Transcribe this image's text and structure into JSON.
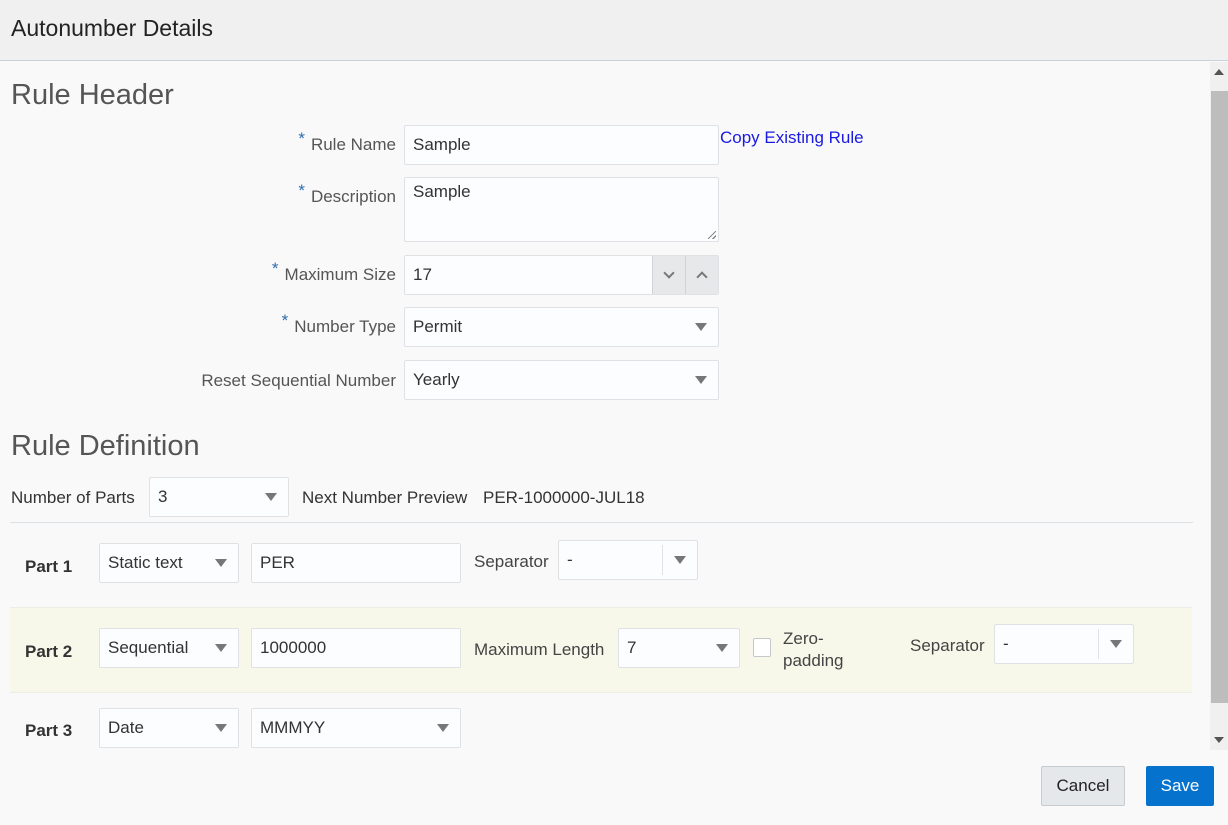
{
  "window": {
    "title": "Autonumber Details"
  },
  "rule_header": {
    "heading": "Rule Header",
    "rule_name": {
      "label": "Rule Name",
      "required": "*",
      "value": "Sample"
    },
    "copy_link": "Copy Existing Rule",
    "description": {
      "label": "Description",
      "required": "*",
      "value": "Sample"
    },
    "maximum_size": {
      "label": "Maximum Size",
      "required": "*",
      "value": "17"
    },
    "number_type": {
      "label": "Number Type",
      "required": "*",
      "value": "Permit"
    },
    "reset_sequential": {
      "label": "Reset Sequential Number",
      "value": "Yearly"
    }
  },
  "rule_definition": {
    "heading": "Rule Definition",
    "number_of_parts": {
      "label": "Number of Parts",
      "value": "3"
    },
    "preview": {
      "label": "Next Number Preview",
      "value": "PER-1000000-JUL18"
    },
    "parts": [
      {
        "label": "Part 1",
        "type": "Static text",
        "value": "PER",
        "separator_label": "Separator",
        "separator": "-"
      },
      {
        "label": "Part 2",
        "type": "Sequential",
        "value": "1000000",
        "max_length_label": "Maximum Length",
        "max_length": "7",
        "zero_padding_label": "Zero-padding",
        "zero_padding_checked": false,
        "separator_label": "Separator",
        "separator": "-"
      },
      {
        "label": "Part 3",
        "type": "Date",
        "format": "MMMYY"
      }
    ]
  },
  "footer": {
    "cancel": "Cancel",
    "save": "Save"
  },
  "colors": {
    "primary": "#0572ce",
    "link": "#1a1ae0",
    "required": "#2d6cae",
    "highlight_row": "#f8f8ea"
  }
}
